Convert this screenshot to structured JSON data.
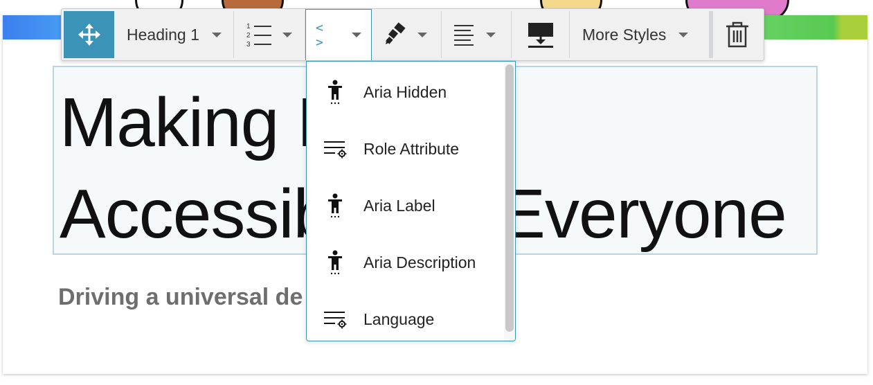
{
  "toolbar": {
    "heading_select": "Heading 1",
    "code_button": "< >",
    "more_styles": "More Styles"
  },
  "editor": {
    "heading_text": "Making Digital Accessible for Everyone",
    "heading_visible_line1": "Making D",
    "heading_visible_line2": "Accessible for Everyone",
    "subtitle_visible": "Driving a universal de"
  },
  "dropdown": {
    "items": [
      {
        "label": "Aria Hidden",
        "icon": "accessibility-person-icon"
      },
      {
        "label": "Role Attribute",
        "icon": "lines-gear-icon"
      },
      {
        "label": "Aria Label",
        "icon": "accessibility-person-icon"
      },
      {
        "label": "Aria Description",
        "icon": "accessibility-person-icon"
      },
      {
        "label": "Language",
        "icon": "lines-gear-icon"
      }
    ]
  },
  "colors": {
    "accent": "#3b94b7",
    "toolbar_bg": "#f0f0f1",
    "editor_bg": "#f5f9fa",
    "editor_border": "#b9d5e2"
  }
}
